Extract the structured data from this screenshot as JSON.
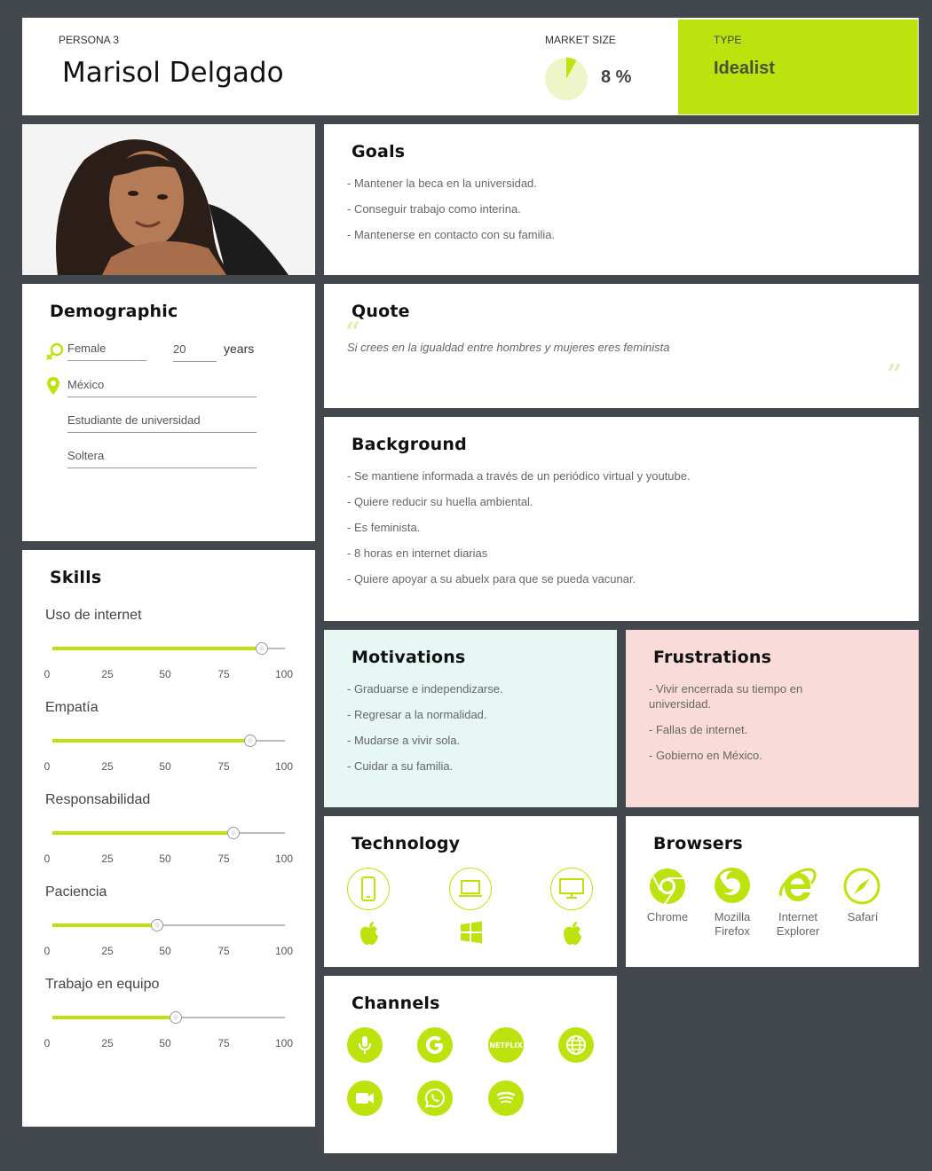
{
  "header": {
    "persona_number": "PERSONA 3",
    "name": "Marisol Delgado",
    "market_size_label": "MARKET SIZE",
    "market_size_value": "8 %",
    "market_size_fraction": 0.08,
    "type_label": "TYPE",
    "type_value": "Idealist"
  },
  "colors": {
    "accent": "#bde30f",
    "background": "#43474e",
    "motivations_bg": "#e6f7f4",
    "frustrations_bg": "#f9dcd9"
  },
  "goals": {
    "title": "Goals",
    "items": [
      "- Mantener la beca en la universidad.",
      "- Conseguir trabajo como interina.",
      "- Mantenerse en contacto con su familia."
    ]
  },
  "demographic": {
    "title": "Demographic",
    "gender": "Female",
    "age": "20",
    "age_unit": "years",
    "location": "México",
    "occupation": "Estudiante de universidad",
    "status": "Soltera",
    "icons": [
      "gender-icon",
      "location-pin-icon"
    ]
  },
  "quote": {
    "title": "Quote",
    "text": "Si crees en la igualdad entre hombres y mujeres eres feminista"
  },
  "background": {
    "title": "Background",
    "items": [
      "- Se mantiene informada a través de un periódico virtual y youtube.",
      "- Quiere reducir su huella ambiental.",
      "- Es feminista.",
      "- 8 horas en internet diarias",
      "- Quiere apoyar a su abuelx para que se pueda vacunar."
    ]
  },
  "skills": {
    "title": "Skills",
    "ticks": [
      "0",
      "25",
      "50",
      "75",
      "100"
    ],
    "items": [
      {
        "name": "Uso de internet",
        "value": 90
      },
      {
        "name": "Empatía",
        "value": 85
      },
      {
        "name": "Responsabilidad",
        "value": 78
      },
      {
        "name": "Paciencia",
        "value": 45
      },
      {
        "name": "Trabajo en equipo",
        "value": 53
      }
    ]
  },
  "motivations": {
    "title": "Motivations",
    "items": [
      "- Graduarse e independizarse.",
      "- Regresar a la normalidad.",
      "- Mudarse a vivir sola.",
      "- Cuidar a su familia."
    ]
  },
  "frustrations": {
    "title": "Frustrations",
    "items": [
      "- Vivir encerrada su tiempo en universidad.",
      "- Fallas de internet.",
      "- Gobierno en México."
    ]
  },
  "technology": {
    "title": "Technology",
    "devices": [
      {
        "device": "smartphone-icon",
        "os": "apple-icon"
      },
      {
        "device": "laptop-icon",
        "os": "windows-icon"
      },
      {
        "device": "desktop-icon",
        "os": "apple-icon"
      }
    ]
  },
  "browsers": {
    "title": "Browsers",
    "items": [
      {
        "icon": "chrome-icon",
        "line1": "Chrome",
        "line2": ""
      },
      {
        "icon": "firefox-icon",
        "line1": "Mozilla",
        "line2": "Firefox"
      },
      {
        "icon": "internet-explorer-icon",
        "line1": "Internet",
        "line2": "Explorer"
      },
      {
        "icon": "safari-icon",
        "line1": "Safarí",
        "line2": ""
      }
    ]
  },
  "channels": {
    "title": "Channels",
    "icons": [
      "microphone-icon",
      "google-icon",
      "netflix-icon",
      "globe-icon",
      "video-camera-icon",
      "whatsapp-icon",
      "spotify-icon"
    ],
    "netflix_text": "NETFLIX"
  }
}
